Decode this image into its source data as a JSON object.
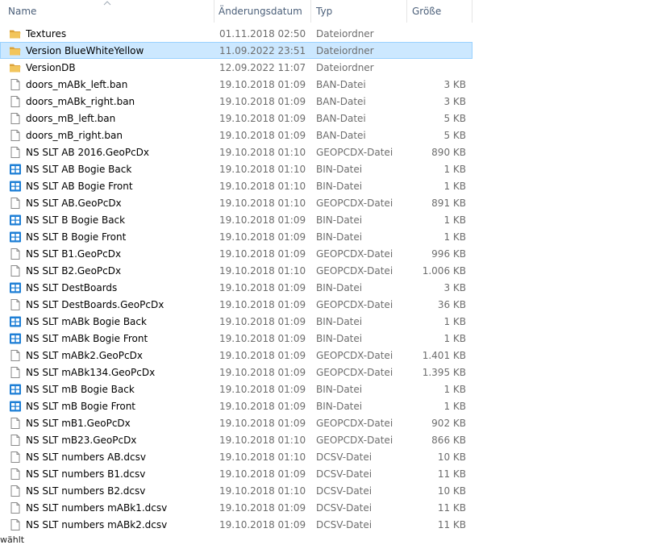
{
  "columns": {
    "name": "Name",
    "date": "Änderungsdatum",
    "type": "Typ",
    "size": "Größe"
  },
  "files": [
    {
      "icon": "folder-icon",
      "name": "Textures",
      "date": "01.11.2018 02:50",
      "type": "Dateiordner",
      "size": ""
    },
    {
      "icon": "folder-icon",
      "name": "Version BlueWhiteYellow",
      "date": "11.09.2022 23:51",
      "type": "Dateiordner",
      "size": "",
      "selected": true
    },
    {
      "icon": "folder-icon",
      "name": "VersionDB",
      "date": "12.09.2022 11:07",
      "type": "Dateiordner",
      "size": ""
    },
    {
      "icon": "file-icon",
      "name": "doors_mABk_left.ban",
      "date": "19.10.2018 01:09",
      "type": "BAN-Datei",
      "size": "3 KB"
    },
    {
      "icon": "file-icon",
      "name": "doors_mABk_right.ban",
      "date": "19.10.2018 01:09",
      "type": "BAN-Datei",
      "size": "3 KB"
    },
    {
      "icon": "file-icon",
      "name": "doors_mB_left.ban",
      "date": "19.10.2018 01:09",
      "type": "BAN-Datei",
      "size": "5 KB"
    },
    {
      "icon": "file-icon",
      "name": "doors_mB_right.ban",
      "date": "19.10.2018 01:09",
      "type": "BAN-Datei",
      "size": "5 KB"
    },
    {
      "icon": "file-icon",
      "name": "NS SLT AB 2016.GeoPcDx",
      "date": "19.10.2018 01:10",
      "type": "GEOPCDX-Datei",
      "size": "890 KB"
    },
    {
      "icon": "bin-icon",
      "name": "NS SLT AB Bogie Back",
      "date": "19.10.2018 01:10",
      "type": "BIN-Datei",
      "size": "1 KB"
    },
    {
      "icon": "bin-icon",
      "name": "NS SLT AB Bogie Front",
      "date": "19.10.2018 01:10",
      "type": "BIN-Datei",
      "size": "1 KB"
    },
    {
      "icon": "file-icon",
      "name": "NS SLT AB.GeoPcDx",
      "date": "19.10.2018 01:10",
      "type": "GEOPCDX-Datei",
      "size": "891 KB"
    },
    {
      "icon": "bin-icon",
      "name": "NS SLT B Bogie Back",
      "date": "19.10.2018 01:09",
      "type": "BIN-Datei",
      "size": "1 KB"
    },
    {
      "icon": "bin-icon",
      "name": "NS SLT B Bogie Front",
      "date": "19.10.2018 01:09",
      "type": "BIN-Datei",
      "size": "1 KB"
    },
    {
      "icon": "file-icon",
      "name": "NS SLT B1.GeoPcDx",
      "date": "19.10.2018 01:09",
      "type": "GEOPCDX-Datei",
      "size": "996 KB"
    },
    {
      "icon": "file-icon",
      "name": "NS SLT B2.GeoPcDx",
      "date": "19.10.2018 01:10",
      "type": "GEOPCDX-Datei",
      "size": "1.006 KB"
    },
    {
      "icon": "bin-icon",
      "name": "NS SLT DestBoards",
      "date": "19.10.2018 01:09",
      "type": "BIN-Datei",
      "size": "3 KB"
    },
    {
      "icon": "file-icon",
      "name": "NS SLT DestBoards.GeoPcDx",
      "date": "19.10.2018 01:09",
      "type": "GEOPCDX-Datei",
      "size": "36 KB"
    },
    {
      "icon": "bin-icon",
      "name": "NS SLT mABk Bogie Back",
      "date": "19.10.2018 01:09",
      "type": "BIN-Datei",
      "size": "1 KB"
    },
    {
      "icon": "bin-icon",
      "name": "NS SLT mABk Bogie Front",
      "date": "19.10.2018 01:09",
      "type": "BIN-Datei",
      "size": "1 KB"
    },
    {
      "icon": "file-icon",
      "name": "NS SLT mABk2.GeoPcDx",
      "date": "19.10.2018 01:09",
      "type": "GEOPCDX-Datei",
      "size": "1.401 KB"
    },
    {
      "icon": "file-icon",
      "name": "NS SLT mABk134.GeoPcDx",
      "date": "19.10.2018 01:09",
      "type": "GEOPCDX-Datei",
      "size": "1.395 KB"
    },
    {
      "icon": "bin-icon",
      "name": "NS SLT mB Bogie Back",
      "date": "19.10.2018 01:09",
      "type": "BIN-Datei",
      "size": "1 KB"
    },
    {
      "icon": "bin-icon",
      "name": "NS SLT mB Bogie Front",
      "date": "19.10.2018 01:09",
      "type": "BIN-Datei",
      "size": "1 KB"
    },
    {
      "icon": "file-icon",
      "name": "NS SLT mB1.GeoPcDx",
      "date": "19.10.2018 01:09",
      "type": "GEOPCDX-Datei",
      "size": "902 KB"
    },
    {
      "icon": "file-icon",
      "name": "NS SLT mB23.GeoPcDx",
      "date": "19.10.2018 01:10",
      "type": "GEOPCDX-Datei",
      "size": "866 KB"
    },
    {
      "icon": "file-icon",
      "name": "NS SLT numbers AB.dcsv",
      "date": "19.10.2018 01:10",
      "type": "DCSV-Datei",
      "size": "10 KB"
    },
    {
      "icon": "file-icon",
      "name": "NS SLT numbers B1.dcsv",
      "date": "19.10.2018 01:09",
      "type": "DCSV-Datei",
      "size": "11 KB"
    },
    {
      "icon": "file-icon",
      "name": "NS SLT numbers B2.dcsv",
      "date": "19.10.2018 01:10",
      "type": "DCSV-Datei",
      "size": "10 KB"
    },
    {
      "icon": "file-icon",
      "name": "NS SLT numbers mABk1.dcsv",
      "date": "19.10.2018 01:09",
      "type": "DCSV-Datei",
      "size": "11 KB"
    },
    {
      "icon": "file-icon",
      "name": "NS SLT numbers mABk2.dcsv",
      "date": "19.10.2018 01:09",
      "type": "DCSV-Datei",
      "size": "11 KB"
    }
  ],
  "statusbar": {
    "text": "wählt"
  },
  "colors": {
    "selection_bg": "#cce8ff",
    "selection_border": "#99d1ff",
    "header_text": "#4c607a",
    "folder": "#e8b84a",
    "bin_icon": "#1e7fd6"
  }
}
